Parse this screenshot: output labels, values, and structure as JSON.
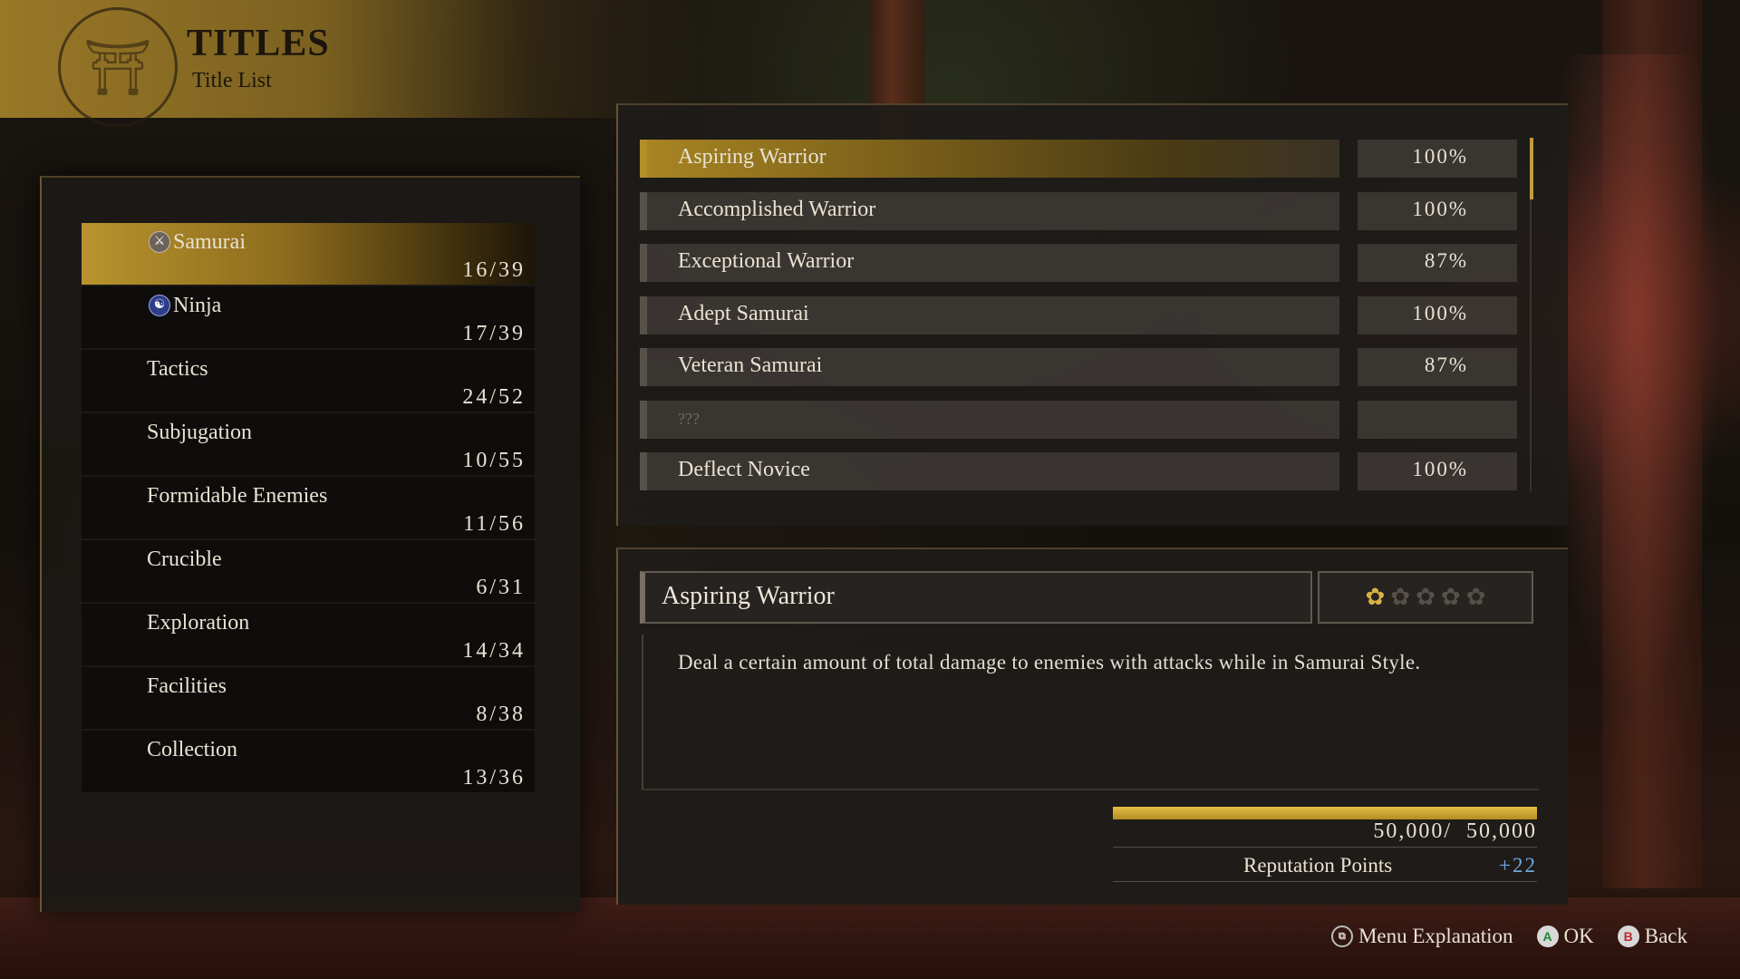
{
  "header": {
    "title": "TITLES",
    "subtitle": "Title List",
    "emblem_icon": "shrine-emblem-icon"
  },
  "categories": [
    {
      "label": "Samurai",
      "count": "16/39",
      "icon": "samurai-style-icon",
      "selected": true
    },
    {
      "label": "Ninja",
      "count": "17/39",
      "icon": "ninja-style-icon",
      "selected": false
    },
    {
      "label": "Tactics",
      "count": "24/52",
      "icon": null,
      "selected": false
    },
    {
      "label": "Subjugation",
      "count": "10/55",
      "icon": null,
      "selected": false
    },
    {
      "label": "Formidable Enemies",
      "count": "11/56",
      "icon": null,
      "selected": false
    },
    {
      "label": "Crucible",
      "count": "6/31",
      "icon": null,
      "selected": false
    },
    {
      "label": "Exploration",
      "count": "14/34",
      "icon": null,
      "selected": false
    },
    {
      "label": "Facilities",
      "count": "8/38",
      "icon": null,
      "selected": false
    },
    {
      "label": "Collection",
      "count": "13/36",
      "icon": null,
      "selected": false
    }
  ],
  "titles": [
    {
      "name": "Aspiring Warrior",
      "percent": "100%",
      "selected": true
    },
    {
      "name": "Accomplished Warrior",
      "percent": "100%",
      "selected": false
    },
    {
      "name": "Exceptional Warrior",
      "percent": "87%",
      "selected": false
    },
    {
      "name": "Adept Samurai",
      "percent": "100%",
      "selected": false
    },
    {
      "name": "Veteran Samurai",
      "percent": "87%",
      "selected": false
    },
    {
      "name": "???",
      "percent": "",
      "selected": false,
      "unknown": true
    },
    {
      "name": "Deflect Novice",
      "percent": "100%",
      "selected": false
    }
  ],
  "detail": {
    "name": "Aspiring Warrior",
    "rank_filled": 1,
    "rank_total": 5,
    "description": "Deal a certain amount of total damage to enemies with attacks while in Samurai Style.",
    "progress_text": "50,000/  50,000",
    "progress_fraction": 1.0,
    "reputation_label": "Reputation Points",
    "reputation_value": "+22"
  },
  "footer": {
    "menu_explanation": "Menu Explanation",
    "ok": "OK",
    "back": "Back",
    "ok_button": "A",
    "back_button": "B"
  },
  "colors": {
    "accent_gold": "#b8932e",
    "reputation_blue": "#6fa8e0"
  }
}
